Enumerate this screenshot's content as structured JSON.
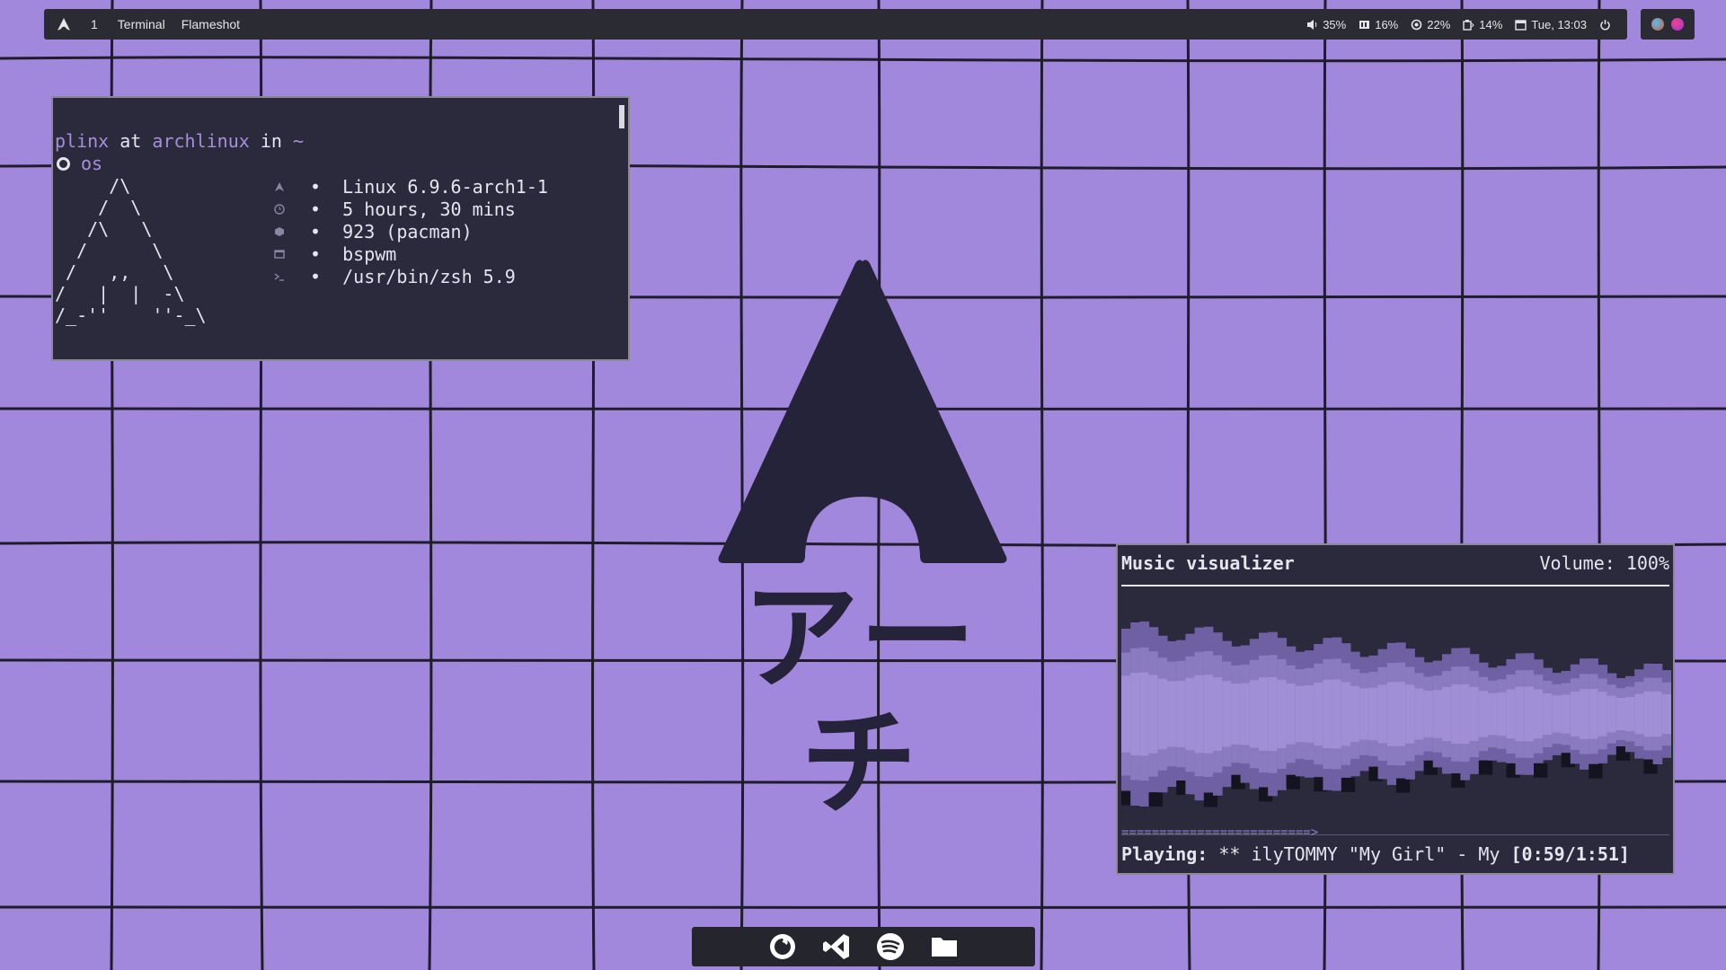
{
  "topbar": {
    "workspace": "1",
    "tasks": [
      "Terminal",
      "Flameshot"
    ],
    "volume": "35%",
    "memory": "16%",
    "cpu": "22%",
    "battery": "14%",
    "clock": "Tue, 13:03"
  },
  "terminal": {
    "user": "plinx",
    "at_word": "at",
    "host": "archlinux",
    "in_word": "in",
    "path": "~",
    "dir": "os",
    "ascii_art": "     /\\\n    /  \\\n   /\\   \\\n  /      \\\n /   ,,   \\\n/   |  |  -\\\n/_-''    ''-_\\",
    "info": [
      {
        "icon": "arch-icon",
        "text": "•  Linux 6.9.6-arch1-1"
      },
      {
        "icon": "clock-icon",
        "text": "•  5 hours, 30 mins"
      },
      {
        "icon": "package-icon",
        "text": "•  923 (pacman)"
      },
      {
        "icon": "window-icon",
        "text": "•  bspwm"
      },
      {
        "icon": "shell-icon",
        "text": "•  /usr/bin/zsh 5.9"
      }
    ]
  },
  "desktop": {
    "katakana": "アーチ"
  },
  "visualizer": {
    "title": "Music visualizer",
    "volume": "Volume: 100%",
    "progress_bar": "=========================>",
    "playing_label": "Playing:",
    "track": " ** ilyTOMMY \"My Girl\" - My ",
    "time": "[0:59/1:51]",
    "progress_fraction": 0.53
  },
  "dock": {
    "apps": [
      "firefox-icon",
      "vscode-icon",
      "spotify-icon",
      "folder-icon"
    ]
  },
  "colors": {
    "background": "#a288dc",
    "panel": "#2b2a3d",
    "accent": "#a78fd9",
    "logo": "#25233a"
  }
}
